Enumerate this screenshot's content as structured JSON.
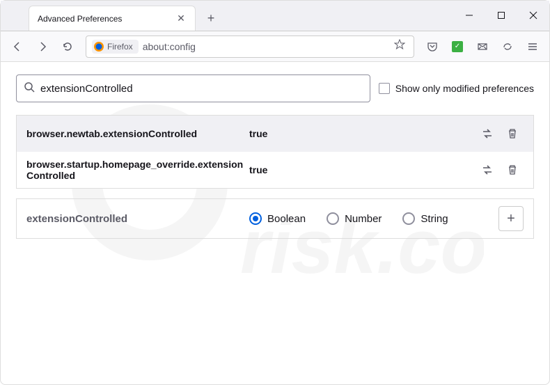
{
  "window": {
    "tab_title": "Advanced Preferences"
  },
  "urlbar": {
    "identity_label": "Firefox",
    "url": "about:config"
  },
  "search": {
    "value": "extensionControlled",
    "modified_label": "Show only modified preferences"
  },
  "prefs": [
    {
      "name": "browser.newtab.extensionControlled",
      "value": "true"
    },
    {
      "name": "browser.startup.homepage_override.extensionControlled",
      "value": "true"
    }
  ],
  "new_pref": {
    "name": "extensionControlled",
    "types": [
      "Boolean",
      "Number",
      "String"
    ],
    "selected": "Boolean"
  }
}
